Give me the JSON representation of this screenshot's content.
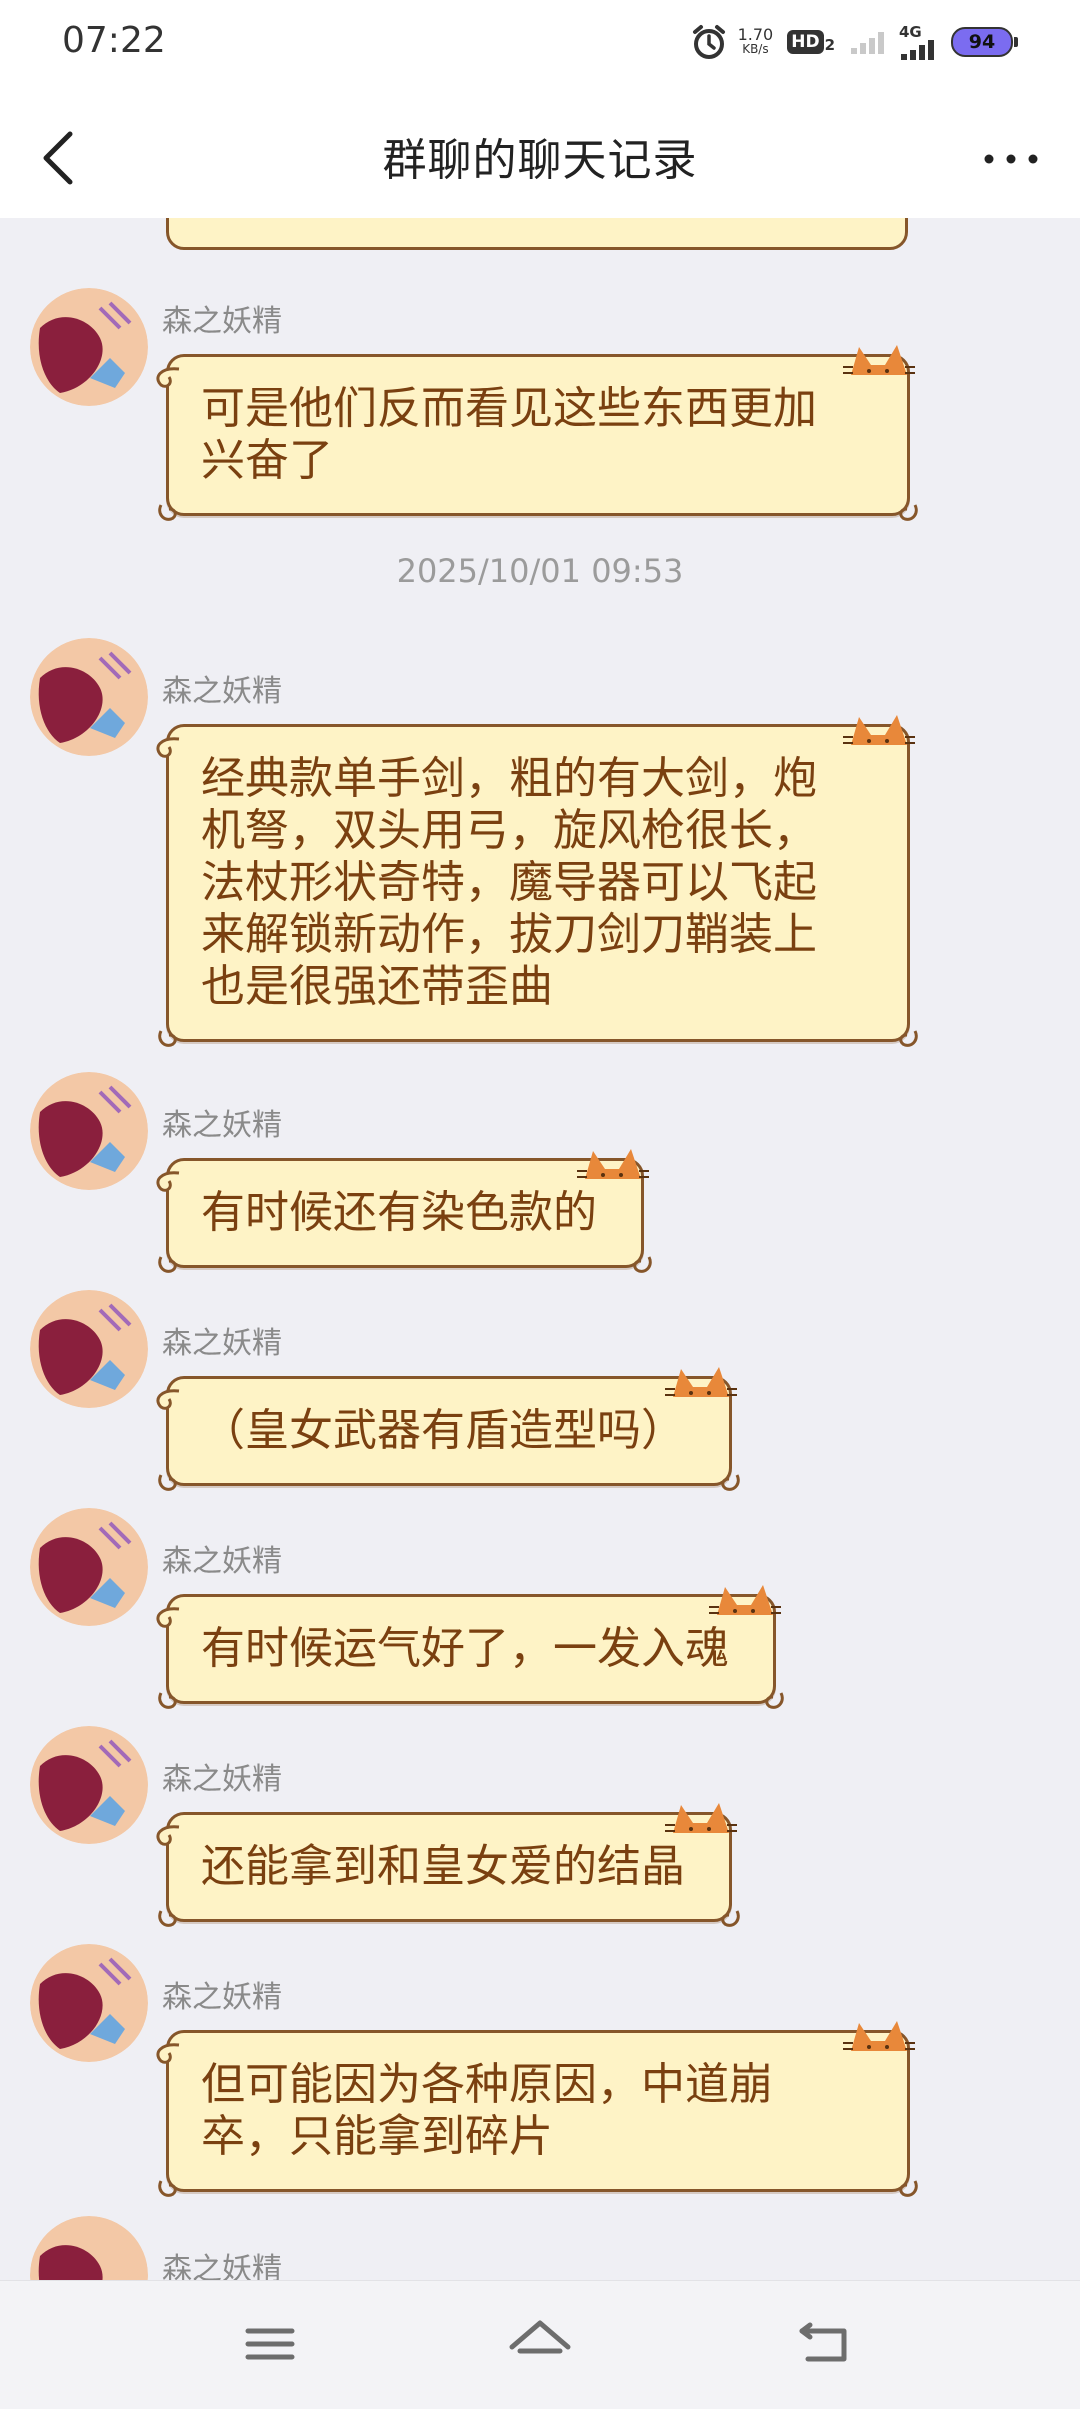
{
  "status_bar": {
    "time": "07:22",
    "net_speed_value": "1.70",
    "net_speed_unit": "KB/s",
    "hd_label": "HD",
    "hd_sub": "2",
    "network_label": "4G",
    "battery_level": "94",
    "icons": [
      "alarm-icon",
      "hd-icon",
      "signal-weak-icon",
      "signal-4g-icon",
      "battery-icon"
    ]
  },
  "header": {
    "title": "群聊的聊天记录",
    "back_icon": "chevron-left-icon",
    "more_icon": "more-horizontal-icon"
  },
  "messages": [
    {
      "sender": "森之妖精",
      "lines": [
        "可是他们反而看见这些东西更加",
        "兴奋了"
      ]
    },
    {
      "timestamp": "2025/10/01 09:53"
    },
    {
      "sender": "森之妖精",
      "lines": [
        "经典款单手剑，粗的有大剑，炮",
        "机弩，双头用弓，旋风枪很长，",
        "法杖形状奇特，魔导器可以飞起",
        "来解锁新动作，拔刀剑刀鞘装上",
        "也是很强还带歪曲"
      ]
    },
    {
      "sender": "森之妖精",
      "lines": [
        "有时候还有染色款的"
      ]
    },
    {
      "sender": "森之妖精",
      "lines": [
        "（皇女武器有盾造型吗）"
      ]
    },
    {
      "sender": "森之妖精",
      "lines": [
        "有时候运气好了，一发入魂"
      ]
    },
    {
      "sender": "森之妖精",
      "lines": [
        "还能拿到和皇女爱的结晶"
      ]
    },
    {
      "sender": "森之妖精",
      "lines": [
        "但可能因为各种原因，中道崩",
        "卒，只能拿到碎片"
      ]
    },
    {
      "sender": "森之妖精",
      "lines": []
    }
  ],
  "bottom_nav": {
    "icons": [
      "menu-icon",
      "home-icon",
      "back-icon"
    ]
  },
  "colors": {
    "bubble_fill": "#fef3c6",
    "bubble_border": "#86562a",
    "bubble_text": "#7a4010",
    "background": "#efeff4",
    "battery_fill": "#7b6cf0"
  }
}
